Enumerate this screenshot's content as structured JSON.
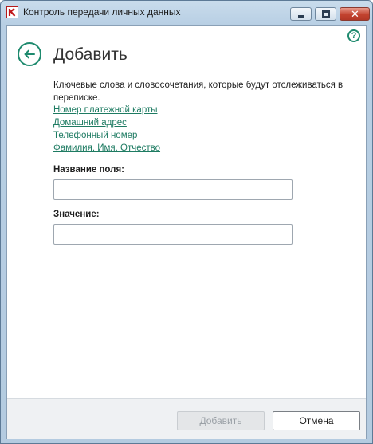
{
  "window": {
    "title": "Контроль передачи личных данных",
    "close_glyph": "✕"
  },
  "header": {
    "title": "Добавить",
    "help_glyph": "?"
  },
  "description": "Ключевые слова и словосочетания, которые будут отслеживаться в переписке.",
  "links": [
    "Номер платежной карты",
    "Домашний адрес",
    "Телефонный номер",
    "Фамилия, Имя, Отчество"
  ],
  "form": {
    "field_name_label": "Название поля:",
    "field_name_value": "",
    "value_label": "Значение:",
    "value_value": ""
  },
  "buttons": {
    "add_label": "Добавить",
    "add_enabled": false,
    "cancel_label": "Отмена"
  },
  "colors": {
    "accent": "#1e8a6e",
    "link": "#1e7b62"
  },
  "icons": {
    "app": "kaspersky-k-icon",
    "help": "question-circle-icon",
    "back": "arrow-left-circle-icon"
  }
}
